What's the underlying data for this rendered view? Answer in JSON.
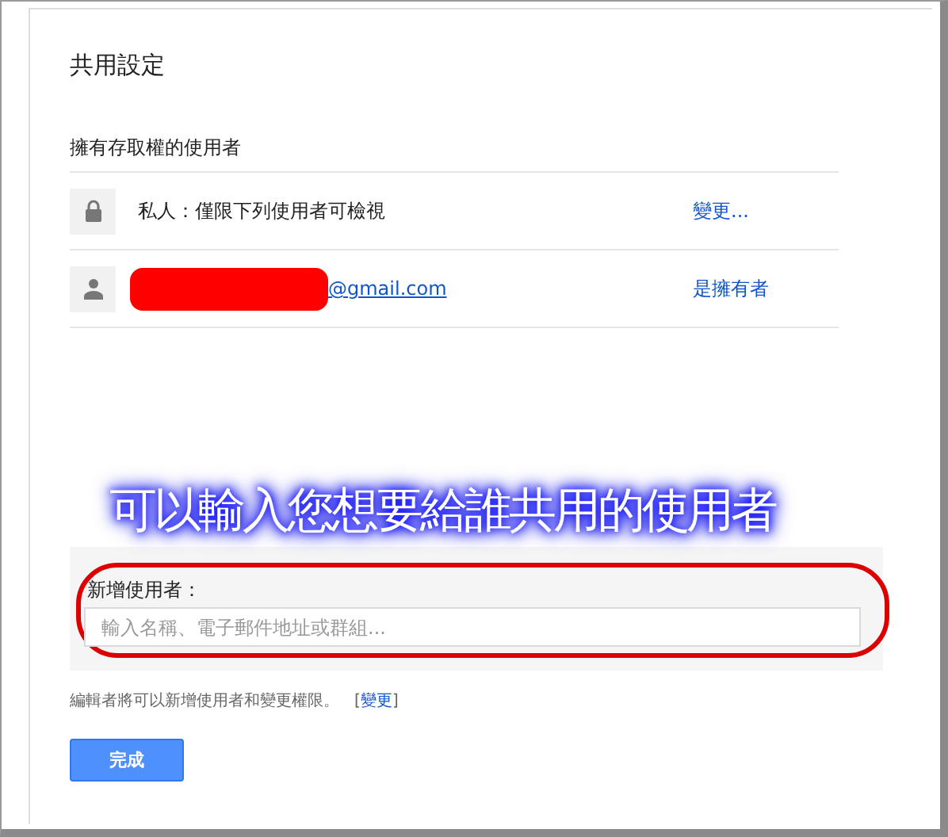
{
  "dialog": {
    "title": "共用設定",
    "section_title": "擁有存取權的使用者"
  },
  "access_rows": [
    {
      "kind": "visibility",
      "label": "私人：僅限下列使用者可檢視",
      "action": "變更...",
      "redacted": false
    },
    {
      "kind": "person",
      "label": "@gmail.com",
      "action": "是擁有者",
      "redacted": true
    }
  ],
  "annotation": {
    "text": "可以輸入您想要給誰共用的使用者",
    "highlight_circled": true
  },
  "add_people": {
    "label": "新增使用者：",
    "placeholder": "輸入名稱、電子郵件地址或群組..."
  },
  "footer": {
    "text": "編輯者將可以新增使用者和變更權限。",
    "bracket_open": "[",
    "link": "變更",
    "bracket_close": "]"
  },
  "buttons": [
    {
      "label": "完成"
    }
  ]
}
